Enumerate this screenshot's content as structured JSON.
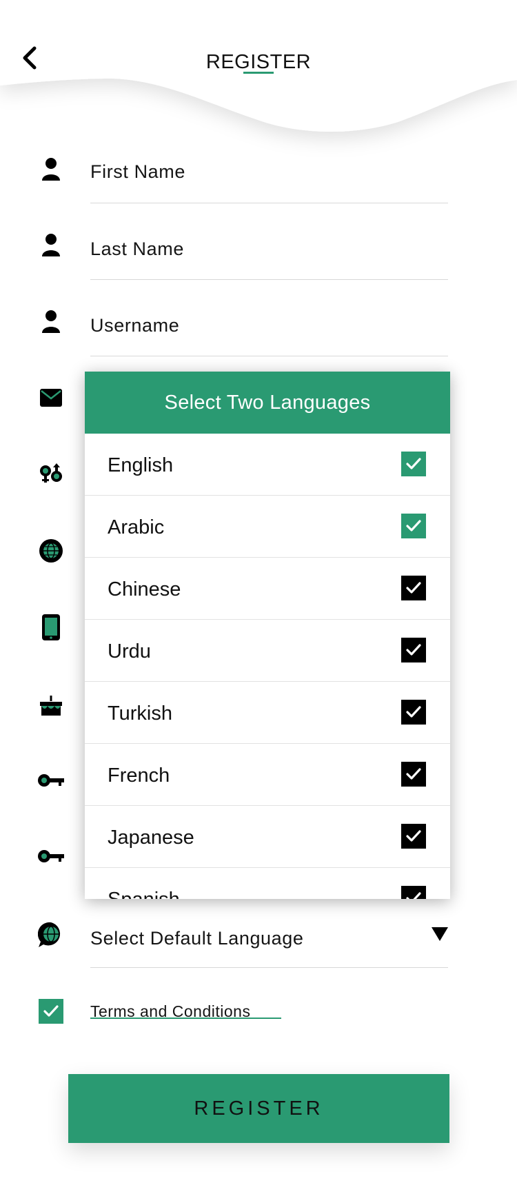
{
  "header": {
    "title": "REGISTER"
  },
  "form": {
    "fields": [
      {
        "label": "First Name",
        "icon": "user-icon"
      },
      {
        "label": "Last Name",
        "icon": "user-icon"
      },
      {
        "label": "Username",
        "icon": "user-icon"
      },
      {
        "label": "",
        "icon": "mail-icon"
      },
      {
        "label": "",
        "icon": "gender-icon"
      },
      {
        "label": "",
        "icon": "globe-icon"
      },
      {
        "label": "",
        "icon": "phone-icon"
      },
      {
        "label": "",
        "icon": "cake-icon"
      },
      {
        "label": "",
        "icon": "key-icon"
      },
      {
        "label": "",
        "icon": "key-icon"
      }
    ],
    "default_language": {
      "label": "Select Default Language",
      "icon": "chat-globe-icon"
    },
    "terms": {
      "label": "Terms and Conditions",
      "checked": true
    },
    "register_button": "REGISTER"
  },
  "modal": {
    "title": "Select Two Languages",
    "languages": [
      {
        "name": "English",
        "selected": true
      },
      {
        "name": "Arabic",
        "selected": true
      },
      {
        "name": "Chinese",
        "selected": false
      },
      {
        "name": "Urdu",
        "selected": false
      },
      {
        "name": "Turkish",
        "selected": false
      },
      {
        "name": "French",
        "selected": false
      },
      {
        "name": "Japanese",
        "selected": false
      },
      {
        "name": "Spanish",
        "selected": false
      }
    ]
  },
  "colors": {
    "accent": "#2a9a72",
    "text": "#111111",
    "divider": "#d8d8d8"
  }
}
